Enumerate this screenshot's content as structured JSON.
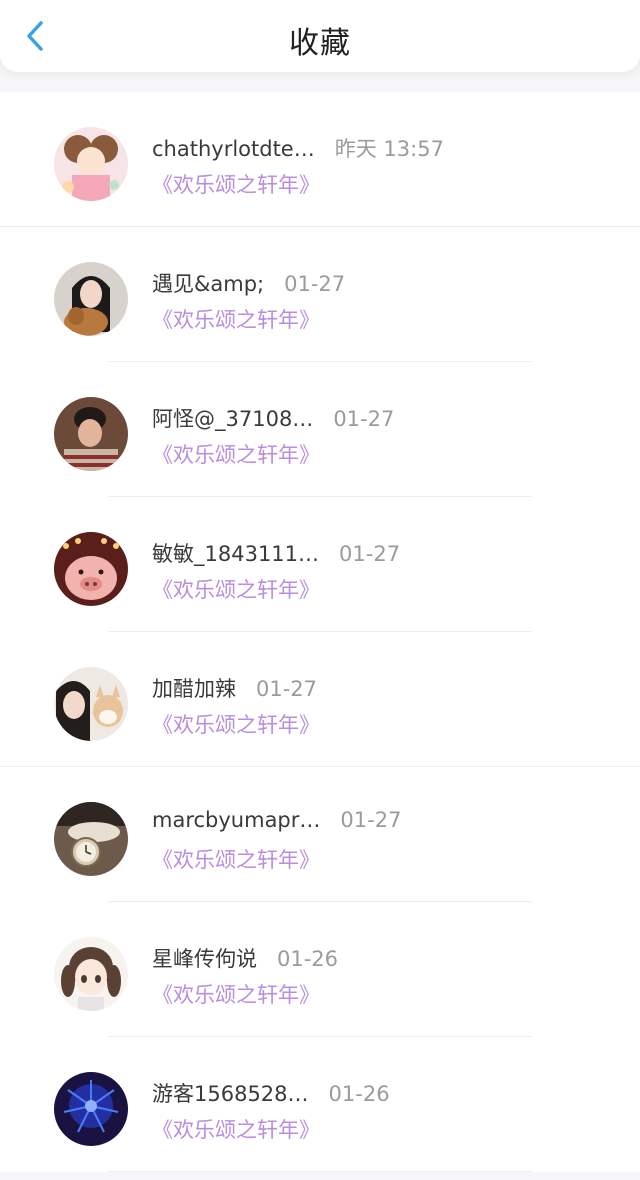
{
  "header": {
    "back_icon": "chevron-left-icon",
    "title": "收藏",
    "accent_color": "#3aa0e8"
  },
  "favorites": [
    {
      "username": "chathyrlotdte…",
      "time": "昨天 13:57",
      "work": "《欢乐颂之轩年》",
      "avatar": "cartoon-girl-avatar"
    },
    {
      "username": "遇见&amp;",
      "time": "01-27",
      "work": "《欢乐颂之轩年》",
      "avatar": "girl-with-dog-avatar"
    },
    {
      "username": "阿怪@_37108…",
      "time": "01-27",
      "work": "《欢乐颂之轩年》",
      "avatar": "young-man-avatar"
    },
    {
      "username": "敏敏_1843111…",
      "time": "01-27",
      "work": "《欢乐颂之轩年》",
      "avatar": "pig-avatar"
    },
    {
      "username": "加醋加辣",
      "time": "01-27",
      "work": "《欢乐颂之轩年》",
      "avatar": "girl-with-shiba-avatar"
    },
    {
      "username": "marcbyumapr…",
      "time": "01-27",
      "work": "《欢乐颂之轩年》",
      "avatar": "pocket-watch-avatar"
    },
    {
      "username": "星峰传佝说",
      "time": "01-26",
      "work": "《欢乐颂之轩年》",
      "avatar": "anime-girl-avatar"
    },
    {
      "username": "游客1568528…",
      "time": "01-26",
      "work": "《欢乐颂之轩年》",
      "avatar": "blue-flower-avatar"
    }
  ],
  "colors": {
    "work_title": "#b98ee0",
    "time": "#9b9b9b",
    "username": "#3a3a3a"
  }
}
